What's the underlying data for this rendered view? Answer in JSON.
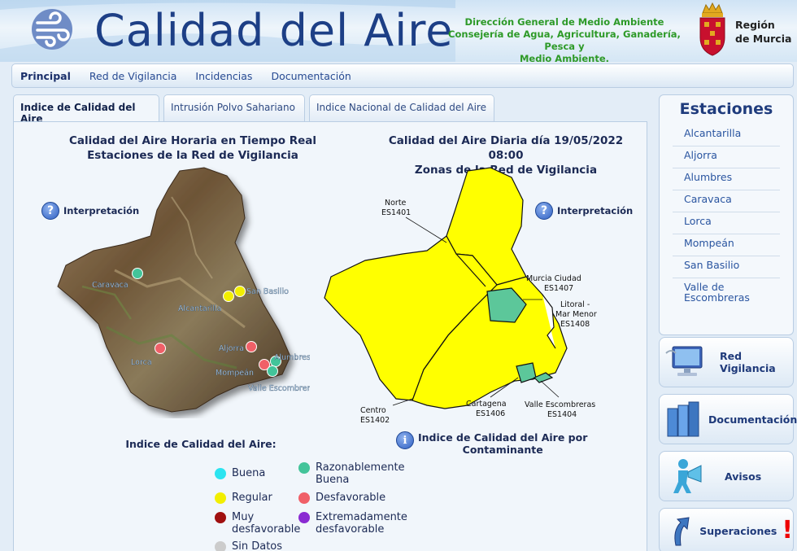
{
  "header": {
    "title": "Calidad del Aire",
    "agency_lines": [
      "Dirección General de Medio Ambiente",
      "Consejería de Agua, Agricultura, Ganadería, Pesca y",
      "Medio Ambiente."
    ],
    "region_lines": [
      "Región",
      "de Murcia"
    ]
  },
  "nav": {
    "items": [
      "Principal",
      "Red de Vigilancia",
      "Incidencias",
      "Documentación"
    ]
  },
  "tabs": [
    "Indice de Calidad del Aire",
    "Intrusión Polvo Sahariano",
    "Indice Nacional de Calidad del Aire"
  ],
  "left_map": {
    "title_lines": [
      "Calidad del Aire Horaria en Tiempo Real",
      "Estaciones de la Red de Vigilancia"
    ],
    "interpretation": "Interpretación",
    "stations": [
      {
        "label": "Caravaca",
        "color": "#43c49a"
      },
      {
        "label": "San Basilio",
        "color": "#f2ee00"
      },
      {
        "label": "Alcantarilla",
        "color": "#f2ee00"
      },
      {
        "label": "Lorca",
        "color": "#f06068"
      },
      {
        "label": "Aljorra",
        "color": "#f06068"
      },
      {
        "label": "Alumbres",
        "color": "#43c49a"
      },
      {
        "label": "Mompeán",
        "color": "#f06068"
      },
      {
        "label": "Valle Escombreras",
        "color": "#43c49a"
      }
    ]
  },
  "right_map": {
    "title_lines": [
      "Calidad del Aire Diaria día 19/05/2022 08:00",
      "Zonas de la Red de Vigilancia"
    ],
    "interpretation": "Interpretación",
    "zone_labels": [
      {
        "name": "Norte",
        "code": "ES1401"
      },
      {
        "name": "Murcia Ciudad",
        "code": "ES1407"
      },
      {
        "name": "Litoral -",
        "name2": "Mar Menor",
        "code": "ES1408"
      },
      {
        "name": "Centro",
        "code": "ES1402"
      },
      {
        "name": "Cartagena",
        "code": "ES1406"
      },
      {
        "name": "Valle Escombreras",
        "code": "ES1404"
      }
    ],
    "colors": {
      "yellow": "#ffff00",
      "green": "#5cc79a"
    }
  },
  "legend": {
    "title": "Indice de Calidad del Aire:",
    "items": [
      {
        "lines": [
          "Buena"
        ],
        "color": "#2ce4f0"
      },
      {
        "lines": [
          "Razonablemente",
          "Buena"
        ],
        "color": "#43c49a"
      },
      {
        "lines": [
          "Regular"
        ],
        "color": "#f2ee00"
      },
      {
        "lines": [
          "Desfavorable"
        ],
        "color": "#f06068"
      },
      {
        "lines": [
          "Muy",
          "desfavorable"
        ],
        "color": "#a01010"
      },
      {
        "lines": [
          "Extremadamente",
          "desfavorable"
        ],
        "color": "#8a2bd2"
      },
      {
        "lines": [
          "Sin Datos"
        ],
        "color": "#cccccc"
      }
    ]
  },
  "pollutant_link": [
    "Indice de Calidad del Aire por",
    "Contaminante"
  ],
  "sidebar": {
    "title": "Estaciones",
    "stations": [
      "Alcantarilla",
      "Aljorra",
      "Alumbres",
      "Caravaca",
      "Lorca",
      "Mompeán",
      "San Basilio",
      "Valle de Escombreras"
    ],
    "buttons": [
      "Red Vigilancia",
      "Documentación",
      "Avisos",
      "Superaciones"
    ]
  }
}
